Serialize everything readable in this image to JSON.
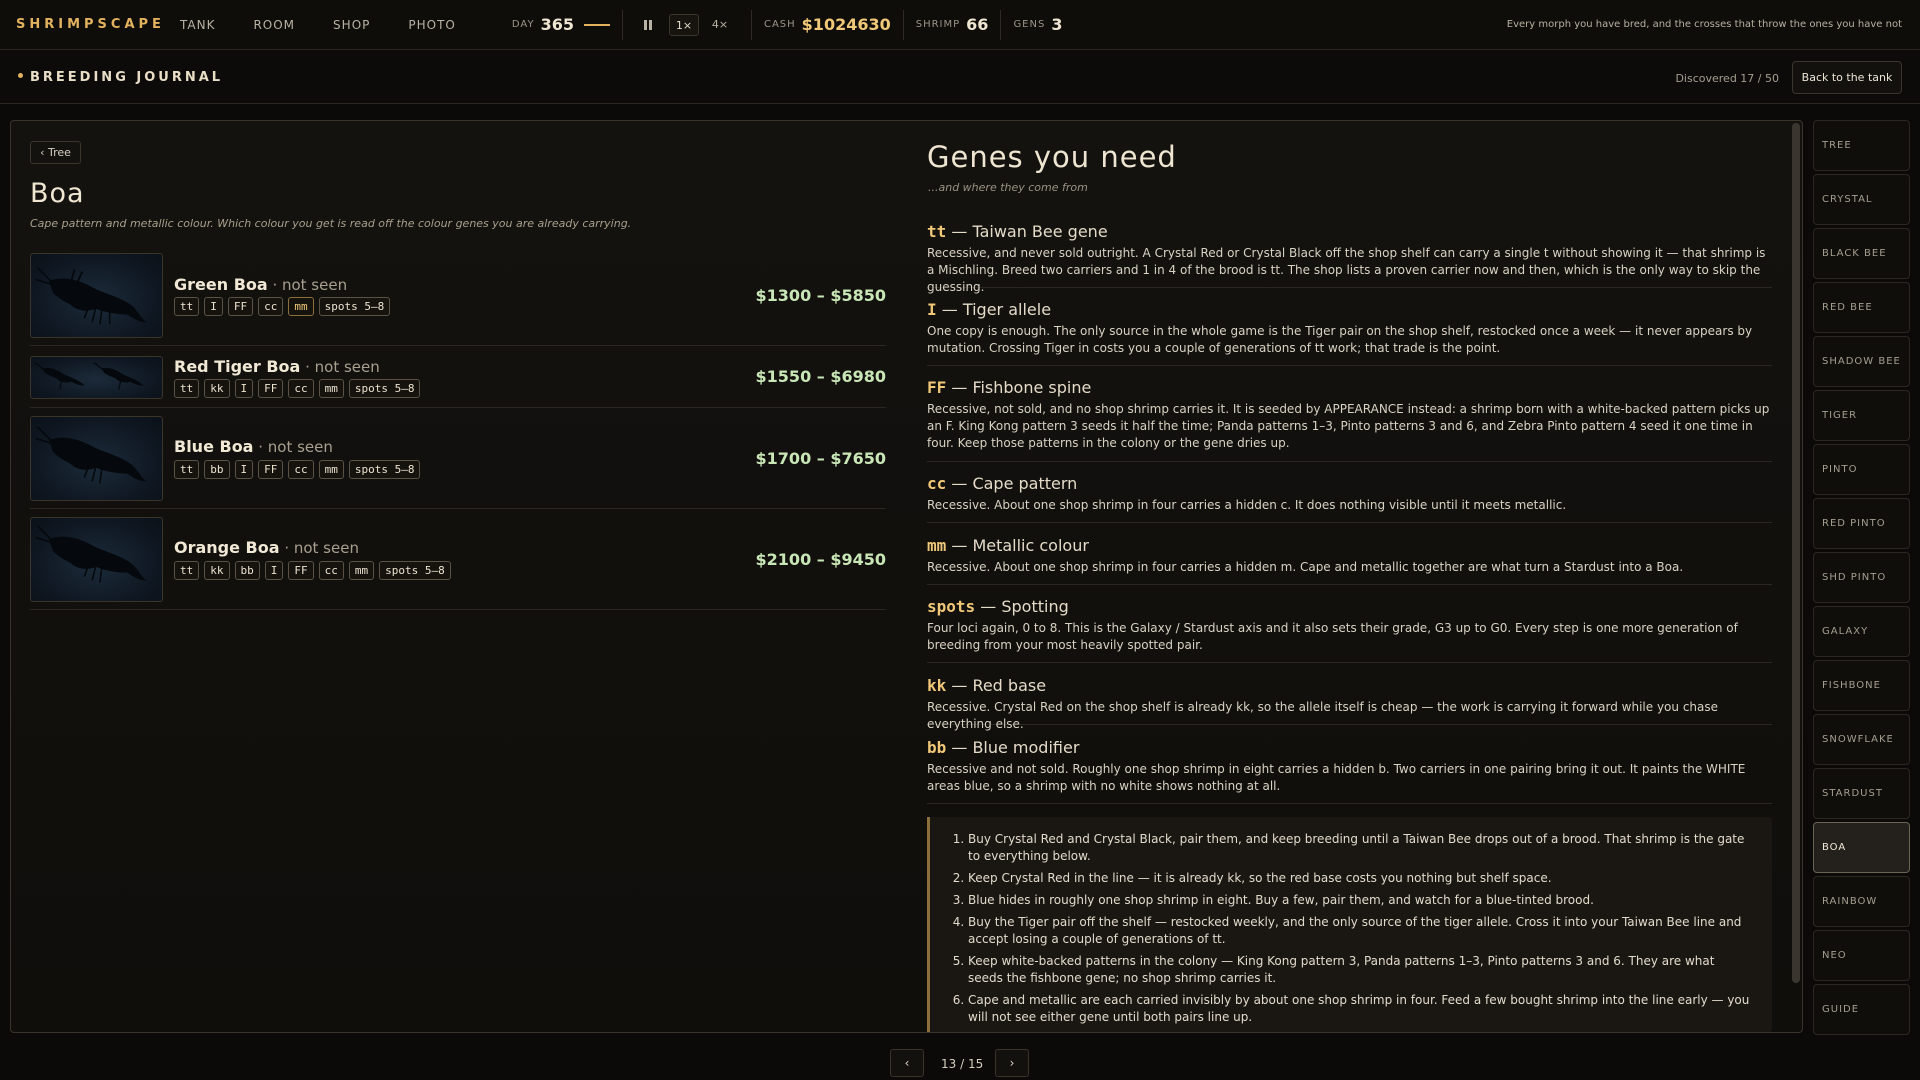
{
  "topbar": {
    "brand": "SHRIMPSCAPE",
    "nav": [
      "TANK",
      "ROOM",
      "SHOP",
      "PHOTO"
    ],
    "day_label": "DAY",
    "day_value": "365",
    "speed_options": [
      "1×",
      "4×"
    ],
    "speed_active": "1×",
    "cash_label": "CASH",
    "cash_value": "$1024630",
    "shrimp_label": "SHRIMP",
    "shrimp_value": "66",
    "gens_label": "GENS",
    "gens_value": "3",
    "hint": "Every morph you have bred, and the crosses that throw the ones you have not"
  },
  "subhead": {
    "title": "BREEDING JOURNAL",
    "discovered": "Discovered 17 / 50",
    "back_label": "Back to the tank"
  },
  "left": {
    "tree_label": "‹ Tree",
    "title": "Boa",
    "subtitle": "Cape pattern and metallic colour. Which colour you get is read off the colour genes you are already carrying.",
    "variants": [
      {
        "name": "Green Boa",
        "status": " · not seen",
        "tags": [
          "tt",
          "I",
          "FF",
          "cc",
          "mm",
          "spots 5–8"
        ],
        "price": "$1300 – $5850"
      },
      {
        "name": "Red Tiger Boa",
        "status": " · not seen",
        "tags": [
          "tt",
          "kk",
          "I",
          "FF",
          "cc",
          "mm",
          "spots 5–8"
        ],
        "price": "$1550 – $6980"
      },
      {
        "name": "Blue Boa",
        "status": " · not seen",
        "tags": [
          "tt",
          "bb",
          "I",
          "FF",
          "cc",
          "mm",
          "spots 5–8"
        ],
        "price": "$1700 – $7650"
      },
      {
        "name": "Orange Boa",
        "status": " · not seen",
        "tags": [
          "tt",
          "kk",
          "bb",
          "I",
          "FF",
          "cc",
          "mm",
          "spots 5–8"
        ],
        "price": "$2100 – $9450"
      }
    ]
  },
  "right": {
    "title": "Genes you need",
    "subtitle": "...and where they come from",
    "genes": [
      {
        "code": "tt",
        "name": " — Taiwan Bee gene",
        "text": "Recessive, and never sold outright. A Crystal Red or Crystal Black off the shop shelf can carry a single t without showing it — that shrimp is a Mischling. Breed two carriers and 1 in 4 of the brood is tt. The shop lists a proven carrier now and then, which is the only way to skip the guessing."
      },
      {
        "code": "I",
        "name": " — Tiger allele",
        "text": "One copy is enough. The only source in the whole game is the Tiger pair on the shop shelf, restocked once a week — it never appears by mutation. Crossing Tiger in costs you a couple of generations of tt work; that trade is the point."
      },
      {
        "code": "FF",
        "name": " — Fishbone spine",
        "text": "Recessive, not sold, and no shop shrimp carries it. It is seeded by APPEARANCE instead: a shrimp born with a white-backed pattern picks up an F. King Kong pattern 3 seeds it half the time; Panda patterns 1–3, Pinto patterns 3 and 6, and Zebra Pinto pattern 4 seed it one time in four. Keep those patterns in the colony or the gene dries up."
      },
      {
        "code": "cc",
        "name": " — Cape pattern",
        "text": "Recessive. About one shop shrimp in four carries a hidden c. It does nothing visible until it meets metallic."
      },
      {
        "code": "mm",
        "name": " — Metallic colour",
        "text": "Recessive. About one shop shrimp in four carries a hidden m. Cape and metallic together are what turn a Stardust into a Boa."
      },
      {
        "code": "spots",
        "name": " — Spotting",
        "text": "Four loci again, 0 to 8. This is the Galaxy / Stardust axis and it also sets their grade, G3 up to G0. Every step is one more generation of breeding from your most heavily spotted pair."
      },
      {
        "code": "kk",
        "name": " — Red base",
        "text": "Recessive. Crystal Red on the shop shelf is already kk, so the allele itself is cheap — the work is carrying it forward while you chase everything else."
      },
      {
        "code": "bb",
        "name": " — Blue modifier",
        "text": "Recessive and not sold. Roughly one shop shrimp in eight carries a hidden b. Two carriers in one pairing bring it out. It paints the WHITE areas blue, so a shrimp with no white shows nothing at all."
      }
    ],
    "steps": [
      "Buy Crystal Red and Crystal Black, pair them, and keep breeding until a Taiwan Bee drops out of a brood. That shrimp is the gate to everything below.",
      "Keep Crystal Red in the line — it is already kk, so the red base costs you nothing but shelf space.",
      "Blue hides in roughly one shop shrimp in eight. Buy a few, pair them, and watch for a blue-tinted brood.",
      "Buy the Tiger pair off the shelf — restocked weekly, and the only source of the tiger allele. Cross it into your Taiwan Bee line and accept losing a couple of generations of tt.",
      "Keep white-backed patterns in the colony — King Kong pattern 3, Panda patterns 1–3, Pinto patterns 3 and 6. They are what seeds the fishbone gene; no shop shrimp carries it.",
      "Cape and metallic are each carried invisibly by about one shop shrimp in four. Feed a few bought shrimp into the line early — you will not see either gene until both pairs line up."
    ]
  },
  "side": {
    "items": [
      "TREE",
      "CRYSTAL",
      "BLACK BEE",
      "RED BEE",
      "SHADOW BEE",
      "TIGER",
      "PINTO",
      "RED PINTO",
      "SHD PINTO",
      "GALAXY",
      "FISHBONE",
      "SNOWFLAKE",
      "STARDUST",
      "BOA",
      "RAINBOW",
      "NEO",
      "GUIDE"
    ],
    "active": "BOA"
  },
  "pager": {
    "prev": "‹",
    "next": "›",
    "text": "13 / 15"
  },
  "colors": {
    "accent": "#e2b25f",
    "price": "#c9e6b7",
    "gene_code": "#f0c878"
  }
}
